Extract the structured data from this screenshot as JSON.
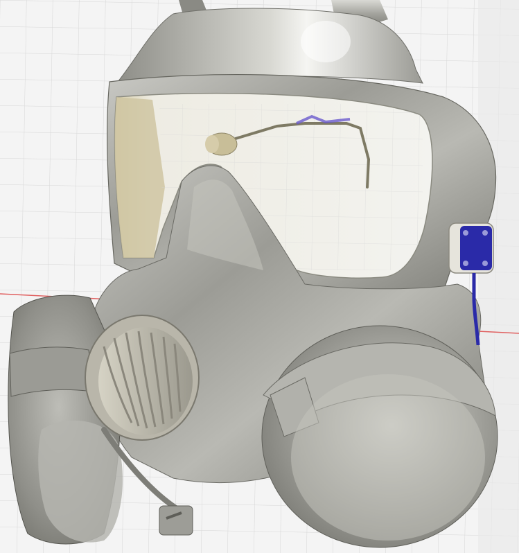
{
  "viewport": {
    "background": "#f4f4f4",
    "grid_color": "#d6d6d6",
    "axis_x_color": "#e06060",
    "axis_y_color": "#55cc55"
  },
  "model": {
    "subject": "gas-mask",
    "body_color": "#a9a9a2",
    "visor_color": "#eef0ec",
    "visor_tint": "#c9bf9a",
    "mic_color": "#b7ad86",
    "cable_color": "#2a2aa8",
    "connector_color": "#e6e4dc"
  }
}
